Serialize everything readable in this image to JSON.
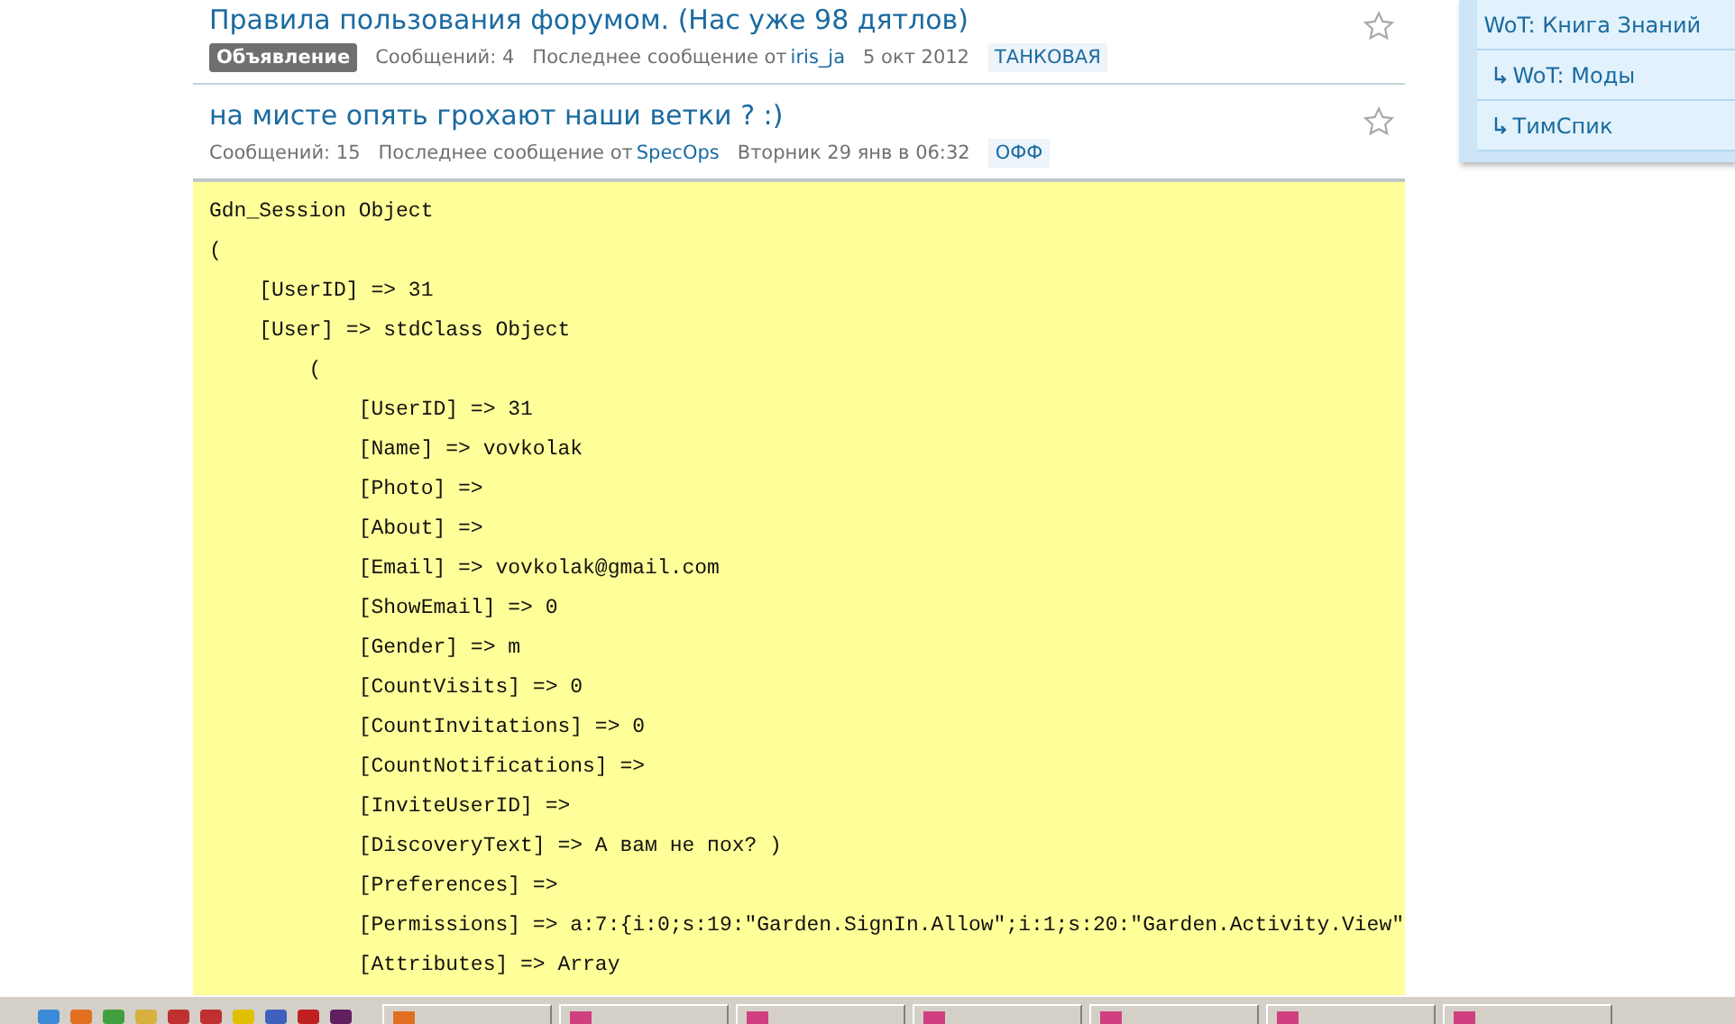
{
  "topics": [
    {
      "title": "Правила пользования форумом. (Нас уже 98 дятлов)",
      "starred": false,
      "badge": "Объявление",
      "comments": "Сообщений: 4",
      "last_label": "Последнее сообщение от",
      "last_user": "iris_ja",
      "date": "5 окт 2012",
      "category": "ТАНКОВАЯ"
    },
    {
      "title": "на мисте опять грохают наши ветки ? :)",
      "starred": false,
      "comments": "Сообщений: 15",
      "last_label": "Последнее сообщение от",
      "last_user": "SpecOps",
      "date": "Вторник 29 янв в 06:32",
      "category": "ОФФ"
    }
  ],
  "sidebar": {
    "items": [
      {
        "label": "WoT: Книга Знаний",
        "children": [
          {
            "label": "WoT: Моды"
          },
          {
            "label": "ТимСпик"
          }
        ]
      }
    ]
  },
  "code_lines": [
    "Gdn_Session Object",
    "(",
    "    [UserID] => 31",
    "    [User] => stdClass Object",
    "        (",
    "            [UserID] => 31",
    "            [Name] => vovkolak",
    "            [Photo] =>",
    "            [About] =>",
    "            [Email] => vovkolak@gmail.com",
    "            [ShowEmail] => 0",
    "            [Gender] => m",
    "            [CountVisits] => 0",
    "            [CountInvitations] => 0",
    "            [CountNotifications] =>",
    "            [InviteUserID] =>",
    "            [DiscoveryText] => А вам не пох? )",
    "            [Preferences] =>",
    "            [Permissions] => a:7:{i:0;s:19:\"Garden.SignIn.Allow\";i:1;s:20:\"Garden.Activity.View\"",
    "            [Attributes] => Array"
  ]
}
